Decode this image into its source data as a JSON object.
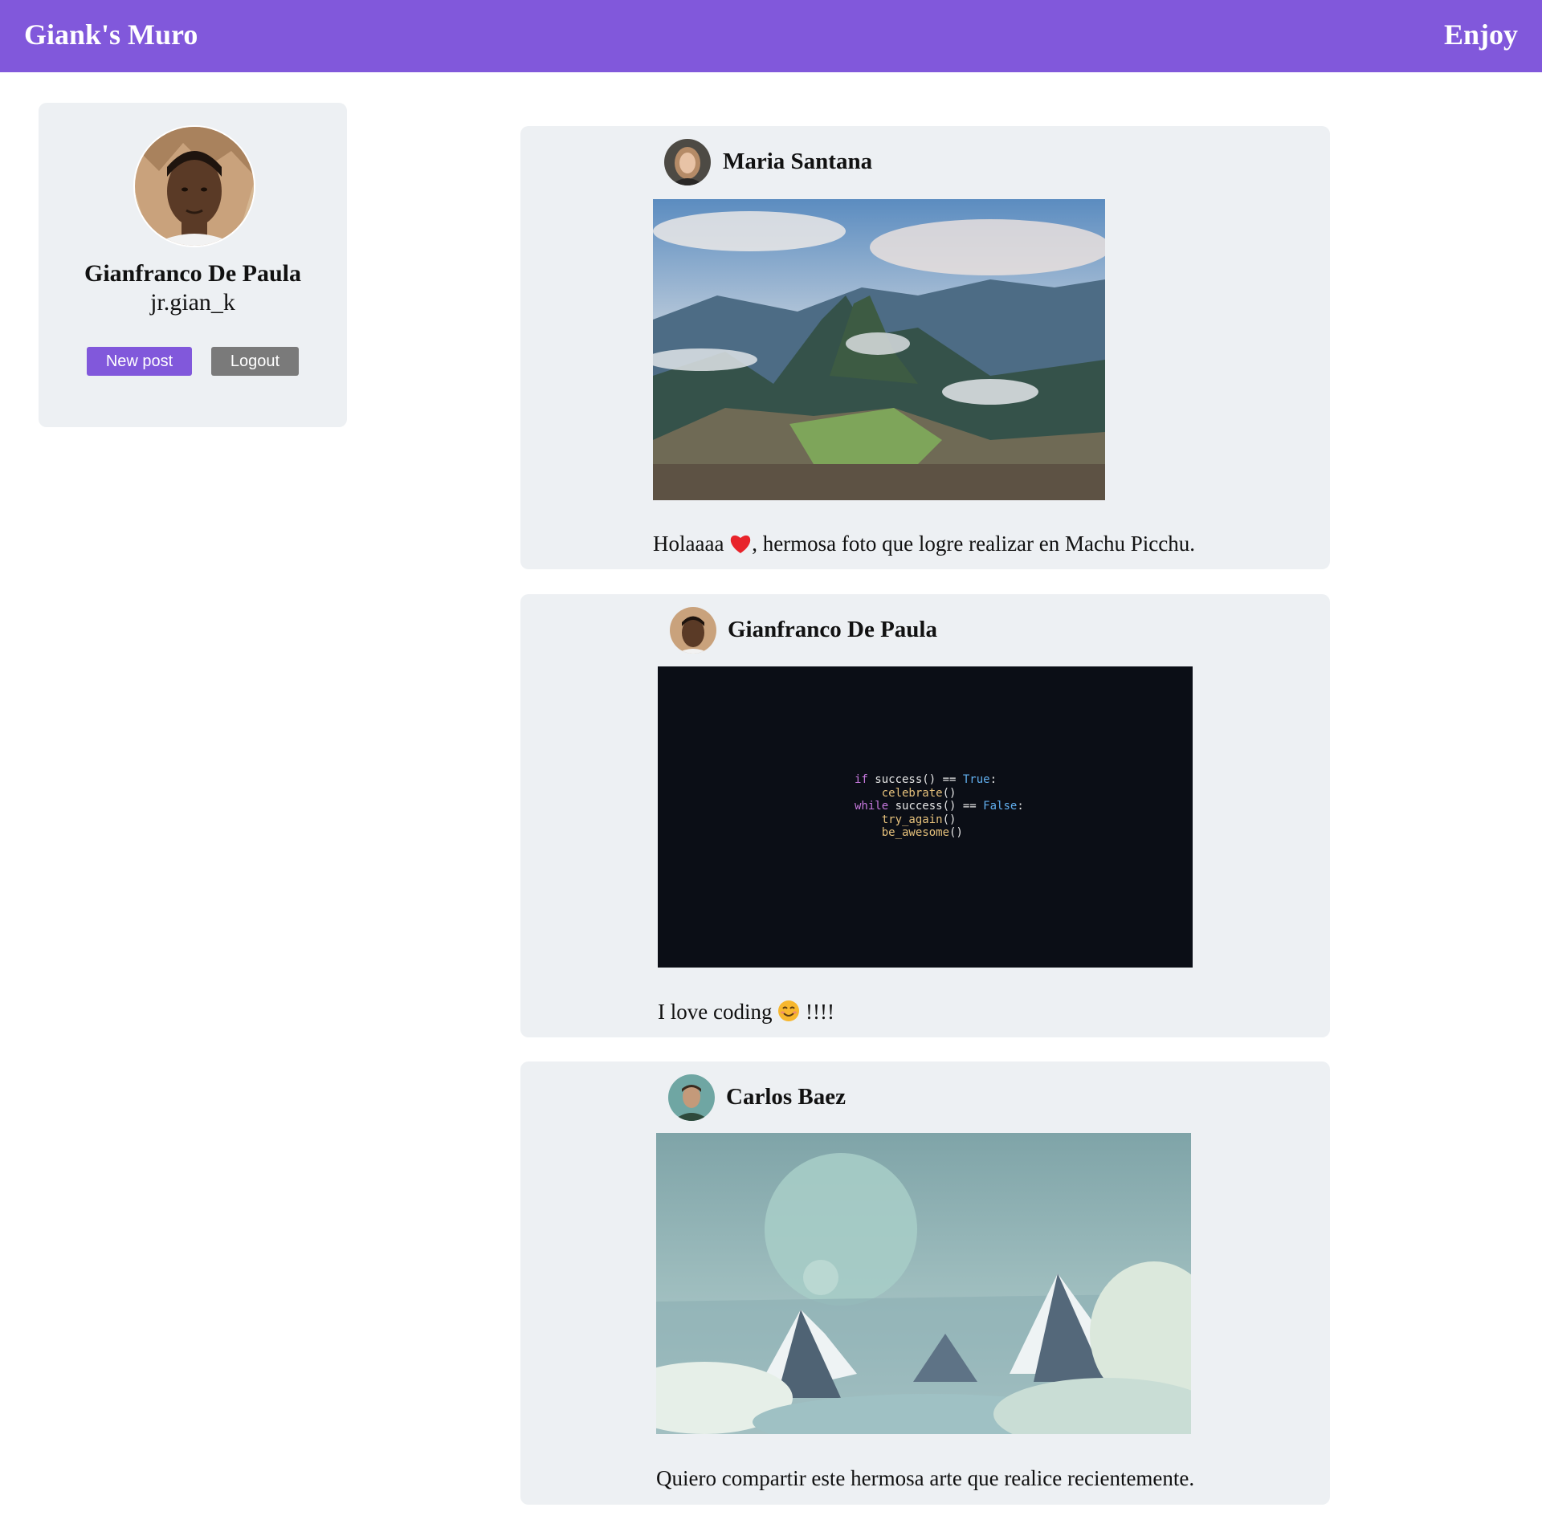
{
  "header": {
    "brand": "Giank's Muro",
    "tagline": "Enjoy"
  },
  "profile": {
    "name": "Gianfranco De Paula",
    "handle": "jr.gian_k",
    "new_post_label": "New post",
    "logout_label": "Logout"
  },
  "posts": [
    {
      "author": "Maria Santana",
      "caption_before": "Holaaaa",
      "caption_after": ", hermosa foto que logre realizar en Machu Picchu."
    },
    {
      "author": "Gianfranco De Paula",
      "caption_before": "I love coding",
      "caption_after": "!!!!",
      "code": {
        "l1_kw": "if",
        "l1_rest": " success() == ",
        "l1_val": "True",
        "l1_end": ":",
        "l2_fn": "celebrate",
        "l2_end": "()",
        "l3_kw": "while",
        "l3_rest": " success() == ",
        "l3_val": "False",
        "l3_end": ":",
        "l4_fn": "try_again",
        "l4_end": "()",
        "l5_fn": "be_awesome",
        "l5_end": "()"
      }
    },
    {
      "author": "Carlos Baez",
      "caption": "Quiero compartir este hermosa arte que realice recientemente."
    }
  ],
  "colors": {
    "accent": "#8158db",
    "card": "#edf0f3",
    "logout": "#7a7a7a",
    "code_bg": "#0b0e16"
  }
}
